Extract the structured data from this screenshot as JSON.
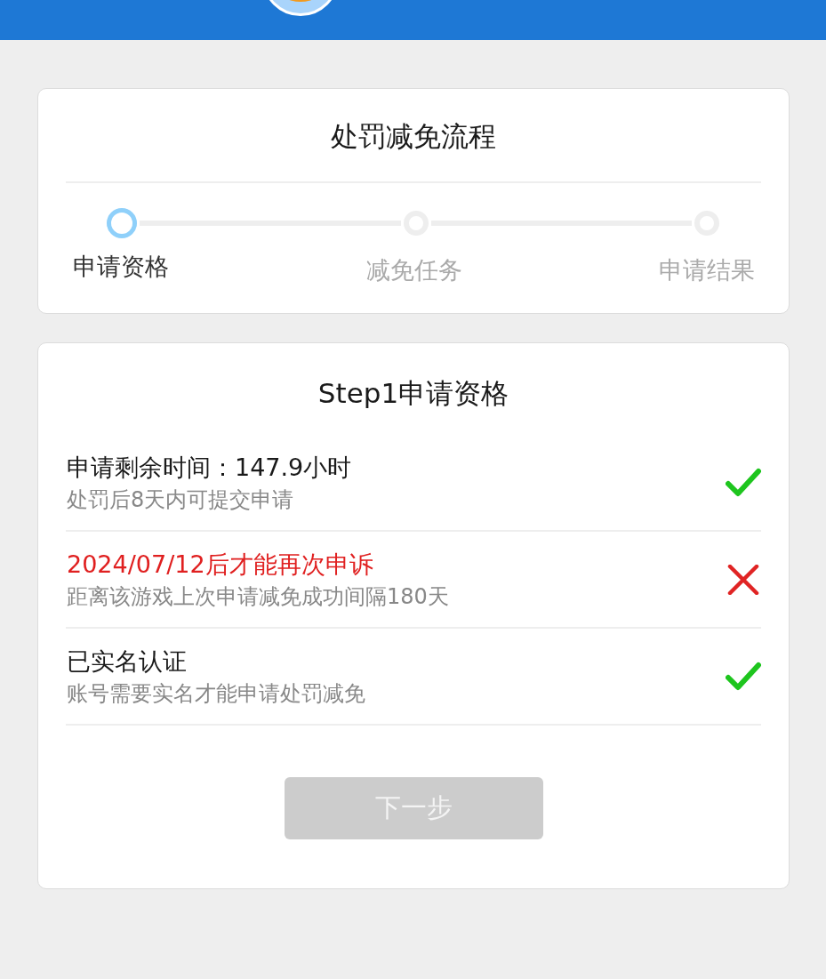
{
  "process_card": {
    "title": "处罚减免流程",
    "steps": [
      {
        "label": "申请资格",
        "selected": true
      },
      {
        "label": "减免任务",
        "selected": false
      },
      {
        "label": "申请结果",
        "selected": false
      }
    ]
  },
  "eligibility_card": {
    "title": "Step1申请资格",
    "checks": [
      {
        "title": "申请剩余时间：147.9小时",
        "note": "处罚后8天内可提交申请",
        "passed": true
      },
      {
        "title": "2024/07/12后才能再次申诉",
        "note": "距离该游戏上次申请减免成功间隔180天",
        "passed": false
      },
      {
        "title": "已实名认证",
        "note": "账号需要实名才能申请处罚减免",
        "passed": true
      }
    ],
    "next_button": {
      "label": "下一步",
      "disabled": true
    }
  }
}
